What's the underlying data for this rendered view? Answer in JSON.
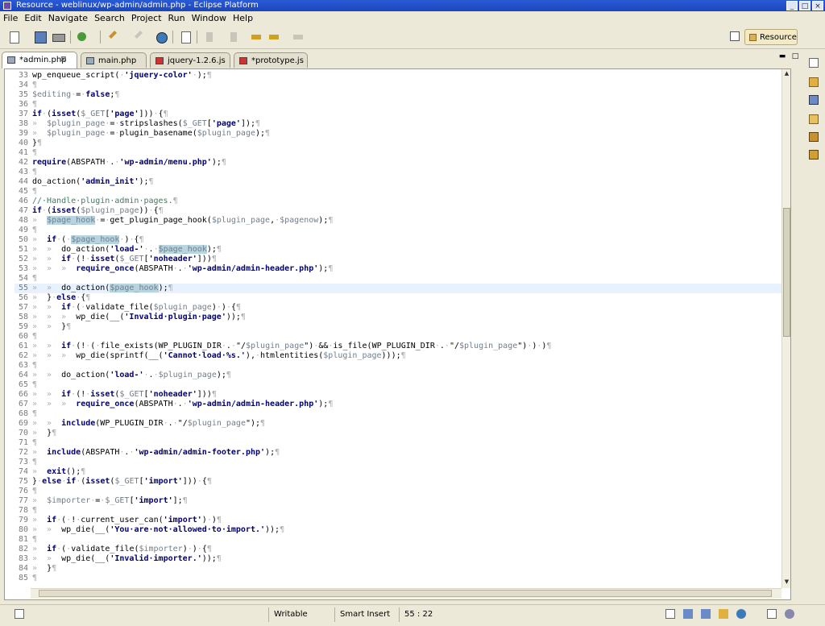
{
  "window": {
    "title": "Resource - weblinux/wp-admin/admin.php - Eclipse Platform",
    "btn_min": "_",
    "btn_max": "□",
    "btn_close": "×"
  },
  "menu": [
    "File",
    "Edit",
    "Navigate",
    "Search",
    "Project",
    "Run",
    "Window",
    "Help"
  ],
  "perspective": {
    "label": "Resource"
  },
  "tabs": [
    {
      "label": "*admin.php",
      "close": "⊠",
      "active": true
    },
    {
      "label": "main.php"
    },
    {
      "label": "jquery-1.2.6.js"
    },
    {
      "label": "*prototype.js"
    }
  ],
  "editor_controls": {
    "minimize": "▬",
    "maximize": "□"
  },
  "status": {
    "writable": "Writable",
    "insert_mode": "Smart Insert",
    "position": "55 : 22"
  },
  "code_lines": [
    {
      "n": "33",
      "h": "wp_enqueue_script(<span class=\"ws\">·</span><span class=\"str\">'jquery-color'</span><span class=\"ws\">·</span>);<span class=\"ws\">¶</span>"
    },
    {
      "n": "34",
      "h": "<span class=\"ws\">¶</span>"
    },
    {
      "n": "35",
      "h": "<span class=\"var\">$editing</span><span class=\"ws\">·</span>=<span class=\"ws\">·</span><span class=\"kw\">false</span>;<span class=\"ws\">¶</span>"
    },
    {
      "n": "36",
      "h": "<span class=\"ws\">¶</span>"
    },
    {
      "n": "37",
      "h": "<span class=\"kw\">if</span><span class=\"ws\">·</span>(<span class=\"kw\">isset</span>(<span class=\"var\">$_GET</span>[<span class=\"str\">'page'</span>]))<span class=\"ws\">·</span>{<span class=\"ws\">¶</span>"
    },
    {
      "n": "38",
      "h": "<span class=\"ws\">»  </span><span class=\"var\">$plugin_page</span><span class=\"ws\">·</span>=<span class=\"ws\">·</span>stripslashes(<span class=\"var\">$_GET</span>[<span class=\"str\">'page'</span>]);<span class=\"ws\">¶</span>"
    },
    {
      "n": "39",
      "h": "<span class=\"ws\">»  </span><span class=\"var\">$plugin_page</span><span class=\"ws\">·</span>=<span class=\"ws\">·</span>plugin_basename(<span class=\"var\">$plugin_page</span>);<span class=\"ws\">¶</span>"
    },
    {
      "n": "40",
      "h": "}<span class=\"ws\">¶</span>"
    },
    {
      "n": "41",
      "h": "<span class=\"ws\">¶</span>"
    },
    {
      "n": "42",
      "h": "<span class=\"kw\">require</span>(ABSPATH<span class=\"ws\">·</span>.<span class=\"ws\">·</span><span class=\"str\">'wp-admin/menu.php'</span>);<span class=\"ws\">¶</span>"
    },
    {
      "n": "43",
      "h": "<span class=\"ws\">¶</span>"
    },
    {
      "n": "44",
      "h": "do_action(<span class=\"str\">'admin_init'</span>);<span class=\"ws\">¶</span>"
    },
    {
      "n": "45",
      "h": "<span class=\"ws\">¶</span>"
    },
    {
      "n": "46",
      "h": "<span class=\"cm\">//·Handle·plugin·admin·pages.</span><span class=\"ws\">¶</span>"
    },
    {
      "n": "47",
      "h": "<span class=\"kw\">if</span><span class=\"ws\">·</span>(<span class=\"kw\">isset</span>(<span class=\"var\">$plugin_page</span>))<span class=\"ws\">·</span>{<span class=\"ws\">¶</span>"
    },
    {
      "n": "48",
      "h": "<span class=\"ws\">»  </span><span class=\"hl\">$page_hook</span><span class=\"ws\">·</span>=<span class=\"ws\">·</span>get_plugin_page_hook(<span class=\"var\">$plugin_page</span>,<span class=\"ws\">·</span><span class=\"var\">$pagenow</span>);<span class=\"ws\">¶</span>"
    },
    {
      "n": "49",
      "h": "<span class=\"ws\">¶</span>"
    },
    {
      "n": "50",
      "h": "<span class=\"ws\">»  </span><span class=\"kw\">if</span><span class=\"ws\">·</span>(<span class=\"ws\">·</span><span class=\"hl\">$page_hook</span><span class=\"ws\">·</span>)<span class=\"ws\">·</span>{<span class=\"ws\">¶</span>"
    },
    {
      "n": "51",
      "h": "<span class=\"ws\">»  »  </span>do_action(<span class=\"str\">'load-'</span><span class=\"ws\">·</span>.<span class=\"ws\">·</span><span class=\"hl\">$page_hook</span>);<span class=\"ws\">¶</span>"
    },
    {
      "n": "52",
      "h": "<span class=\"ws\">»  »  </span><span class=\"kw\">if</span><span class=\"ws\">·</span>(!<span class=\"ws\">·</span><span class=\"kw\">isset</span>(<span class=\"var\">$_GET</span>[<span class=\"str\">'noheader'</span>]))<span class=\"ws\">¶</span>"
    },
    {
      "n": "53",
      "h": "<span class=\"ws\">»  »  »  </span><span class=\"kw\">require_once</span>(ABSPATH<span class=\"ws\">·</span>.<span class=\"ws\">·</span><span class=\"str\">'wp-admin/admin-header.php'</span>);<span class=\"ws\">¶</span>"
    },
    {
      "n": "54",
      "h": "<span class=\"ws\">¶</span>"
    },
    {
      "n": "55",
      "h": "<span class=\"ws\">»  »  </span>do_action(<span class=\"hl\">$page_hook</span>);<span class=\"ws\">¶</span>",
      "cur": true
    },
    {
      "n": "56",
      "h": "<span class=\"ws\">»  </span>}<span class=\"ws\">·</span><span class=\"kw\">else</span><span class=\"ws\">·</span>{<span class=\"ws\">¶</span>"
    },
    {
      "n": "57",
      "h": "<span class=\"ws\">»  »  </span><span class=\"kw\">if</span><span class=\"ws\">·</span>(<span class=\"ws\">·</span>validate_file(<span class=\"var\">$plugin_page</span>)<span class=\"ws\">·</span>)<span class=\"ws\">·</span>{<span class=\"ws\">¶</span>"
    },
    {
      "n": "58",
      "h": "<span class=\"ws\">»  »  »  </span>wp_die(__(<span class=\"str\">'Invalid·plugin·page'</span>));<span class=\"ws\">¶</span>"
    },
    {
      "n": "59",
      "h": "<span class=\"ws\">»  »  </span>}<span class=\"ws\">¶</span>"
    },
    {
      "n": "60",
      "h": "<span class=\"ws\">¶</span>"
    },
    {
      "n": "61",
      "h": "<span class=\"ws\">»  »  </span><span class=\"kw\">if</span><span class=\"ws\">·</span>(!<span class=\"ws\">·</span>(<span class=\"ws\">·</span>file_exists(WP_PLUGIN_DIR<span class=\"ws\">·</span>.<span class=\"ws\">·</span>\"/<span class=\"var\">$plugin_page</span>\")<span class=\"ws\">·</span>&amp;&amp;<span class=\"ws\">·</span>is_file(WP_PLUGIN_DIR<span class=\"ws\">·</span>.<span class=\"ws\">·</span>\"/<span class=\"var\">$plugin_page</span>\")<span class=\"ws\">·</span>)<span class=\"ws\">·</span>)<span class=\"ws\">¶</span>"
    },
    {
      "n": "62",
      "h": "<span class=\"ws\">»  »  »  </span>wp_die(sprintf(__(<span class=\"str\">'Cannot·load·%s.'</span>),<span class=\"ws\">·</span>htmlentities(<span class=\"var\">$plugin_page</span>)));<span class=\"ws\">¶</span>"
    },
    {
      "n": "63",
      "h": "<span class=\"ws\">¶</span>"
    },
    {
      "n": "64",
      "h": "<span class=\"ws\">»  »  </span>do_action(<span class=\"str\">'load-'</span><span class=\"ws\">·</span>.<span class=\"ws\">·</span><span class=\"var\">$plugin_page</span>);<span class=\"ws\">¶</span>"
    },
    {
      "n": "65",
      "h": "<span class=\"ws\">¶</span>"
    },
    {
      "n": "66",
      "h": "<span class=\"ws\">»  »  </span><span class=\"kw\">if</span><span class=\"ws\">·</span>(!<span class=\"ws\">·</span><span class=\"kw\">isset</span>(<span class=\"var\">$_GET</span>[<span class=\"str\">'noheader'</span>]))<span class=\"ws\">¶</span>"
    },
    {
      "n": "67",
      "h": "<span class=\"ws\">»  »  »  </span><span class=\"kw\">require_once</span>(ABSPATH<span class=\"ws\">·</span>.<span class=\"ws\">·</span><span class=\"str\">'wp-admin/admin-header.php'</span>);<span class=\"ws\">¶</span>"
    },
    {
      "n": "68",
      "h": "<span class=\"ws\">¶</span>"
    },
    {
      "n": "69",
      "h": "<span class=\"ws\">»  »  </span><span class=\"kw\">include</span>(WP_PLUGIN_DIR<span class=\"ws\">·</span>.<span class=\"ws\">·</span>\"/<span class=\"var\">$plugin_page</span>\");<span class=\"ws\">¶</span>"
    },
    {
      "n": "70",
      "h": "<span class=\"ws\">»  </span>}<span class=\"ws\">¶</span>"
    },
    {
      "n": "71",
      "h": "<span class=\"ws\">¶</span>"
    },
    {
      "n": "72",
      "h": "<span class=\"ws\">»  </span><span class=\"kw\">include</span>(ABSPATH<span class=\"ws\">·</span>.<span class=\"ws\">·</span><span class=\"str\">'wp-admin/admin-footer.php'</span>);<span class=\"ws\">¶</span>"
    },
    {
      "n": "73",
      "h": "<span class=\"ws\">¶</span>"
    },
    {
      "n": "74",
      "h": "<span class=\"ws\">»  </span><span class=\"kw\">exit</span>();<span class=\"ws\">¶</span>"
    },
    {
      "n": "75",
      "h": "}<span class=\"ws\">·</span><span class=\"kw\">else</span><span class=\"ws\">·</span><span class=\"kw\">if</span><span class=\"ws\">·</span>(<span class=\"kw\">isset</span>(<span class=\"var\">$_GET</span>[<span class=\"str\">'import'</span>]))<span class=\"ws\">·</span>{<span class=\"ws\">¶</span>"
    },
    {
      "n": "76",
      "h": "<span class=\"ws\">¶</span>"
    },
    {
      "n": "77",
      "h": "<span class=\"ws\">»  </span><span class=\"var\">$importer</span><span class=\"ws\">·</span>=<span class=\"ws\">·</span><span class=\"var\">$_GET</span>[<span class=\"str\">'import'</span>];<span class=\"ws\">¶</span>"
    },
    {
      "n": "78",
      "h": "<span class=\"ws\">¶</span>"
    },
    {
      "n": "79",
      "h": "<span class=\"ws\">»  </span><span class=\"kw\">if</span><span class=\"ws\">·</span>(<span class=\"ws\">·</span>!<span class=\"ws\">·</span>current_user_can(<span class=\"str\">'import'</span>)<span class=\"ws\">·</span>)<span class=\"ws\">¶</span>"
    },
    {
      "n": "80",
      "h": "<span class=\"ws\">»  »  </span>wp_die(__(<span class=\"str\">'You·are·not·allowed·to·import.'</span>));<span class=\"ws\">¶</span>"
    },
    {
      "n": "81",
      "h": "<span class=\"ws\">¶</span>"
    },
    {
      "n": "82",
      "h": "<span class=\"ws\">»  </span><span class=\"kw\">if</span><span class=\"ws\">·</span>(<span class=\"ws\">·</span>validate_file(<span class=\"var\">$importer</span>)<span class=\"ws\">·</span>)<span class=\"ws\">·</span>{<span class=\"ws\">¶</span>"
    },
    {
      "n": "83",
      "h": "<span class=\"ws\">»  »  </span>wp_die(__(<span class=\"str\">'Invalid·importer.'</span>));<span class=\"ws\">¶</span>"
    },
    {
      "n": "84",
      "h": "<span class=\"ws\">»  </span>}<span class=\"ws\">¶</span>"
    },
    {
      "n": "85",
      "h": "<span class=\"ws\">¶</span>"
    }
  ]
}
